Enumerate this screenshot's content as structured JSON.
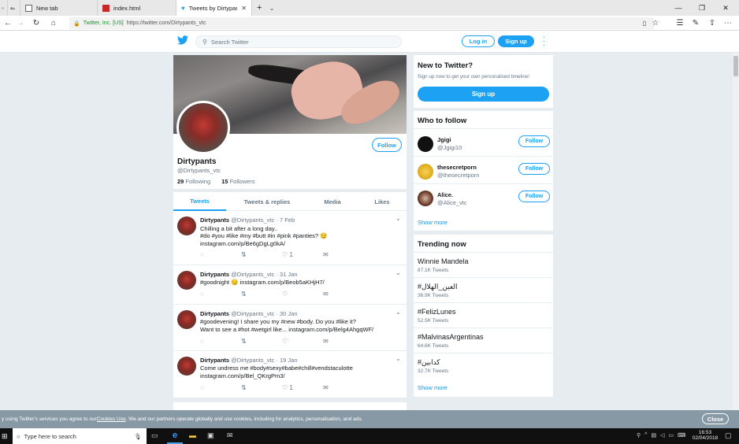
{
  "browser": {
    "tabs": [
      {
        "label": "New tab"
      },
      {
        "label": "index.html"
      },
      {
        "label": "Tweets by Dirtypants (@"
      }
    ],
    "address": {
      "org": "Twitter, Inc. [US]",
      "url": "https://twitter.com/Dirtypants_vtc"
    }
  },
  "header": {
    "search_placeholder": "Search Twitter",
    "login_label": "Log in",
    "signup_label": "Sign up"
  },
  "profile": {
    "name": "Dirtypants",
    "handle": "@Dirtypants_vtc",
    "following_count": "29",
    "following_label": "Following",
    "followers_count": "15",
    "followers_label": "Followers",
    "follow_label": "Follow"
  },
  "tabs": [
    {
      "label": "Tweets"
    },
    {
      "label": "Tweets & replies"
    },
    {
      "label": "Media"
    },
    {
      "label": "Likes"
    }
  ],
  "tweets": [
    {
      "name": "Dirtypants",
      "meta": "@Dirtypants_vtc · 7 Feb",
      "line1": "Chilling a bit after a long day..",
      "line2": "#do #you #like #my #butt #in #pink #panties? 😏",
      "line3": "instagram.com/p/Be6gDgLg0kA/",
      "likes": "1"
    },
    {
      "name": "Dirtypants",
      "meta": "@Dirtypants_vtc · 31 Jan",
      "line1": "#goodnight 😏 instagram.com/p/Beob5aKHjH7/",
      "likes": ""
    },
    {
      "name": "Dirtypants",
      "meta": "@Dirtypants_vtc · 30 Jan",
      "line1": "#goodevening! I share you my #new #body. Do you #like it?",
      "line2": "Want to see a #hot #wetgirl like... instagram.com/p/Belg4AhgqWF/",
      "likes": ""
    },
    {
      "name": "Dirtypants",
      "meta": "@Dirtypants_vtc · 19 Jan",
      "line1": "Come undress me #body#sexy#babe#chill#vendstaculotte",
      "line2": "instagram.com/p/Bel_QKrgPm3/",
      "likes": "1"
    }
  ],
  "sidebar": {
    "new_title": "New to Twitter?",
    "new_sub": "Sign up now to get your own personalised timeline!",
    "signup_label": "Sign up",
    "wtf_title": "Who to follow",
    "wtf": [
      {
        "name": "Jgigi",
        "handle": "@Jgigi10",
        "follow": "Follow"
      },
      {
        "name": "thesecretporn",
        "handle": "@thesecretporn",
        "follow": "Follow"
      },
      {
        "name": "Alice.",
        "handle": "@Alice_vtc",
        "follow": "Follow"
      }
    ],
    "show_more": "Show more",
    "trend_title": "Trending now",
    "trends": [
      {
        "name": "Winnie Mandela",
        "count": "87.1K Tweets"
      },
      {
        "name": "#العين_الهلال",
        "count": "36.9K Tweets"
      },
      {
        "name": "#FelizLunes",
        "count": "52.5K Tweets"
      },
      {
        "name": "#MalvinasArgentinas",
        "count": "64.6K Tweets"
      },
      {
        "name": "#كدابين",
        "count": "32.7K Tweets"
      }
    ],
    "trend_show_more": "Show more"
  },
  "cookie": {
    "text_a": "y using Twitter's services you agree to our ",
    "link": "Cookies Use",
    "text_b": ". We and our partners operate globally and use cookies, including for analytics, personalisation, and ads.",
    "close_label": "Close"
  },
  "taskbar": {
    "search_placeholder": "Type here to search",
    "time": "16:53",
    "date": "02/04/2018"
  }
}
